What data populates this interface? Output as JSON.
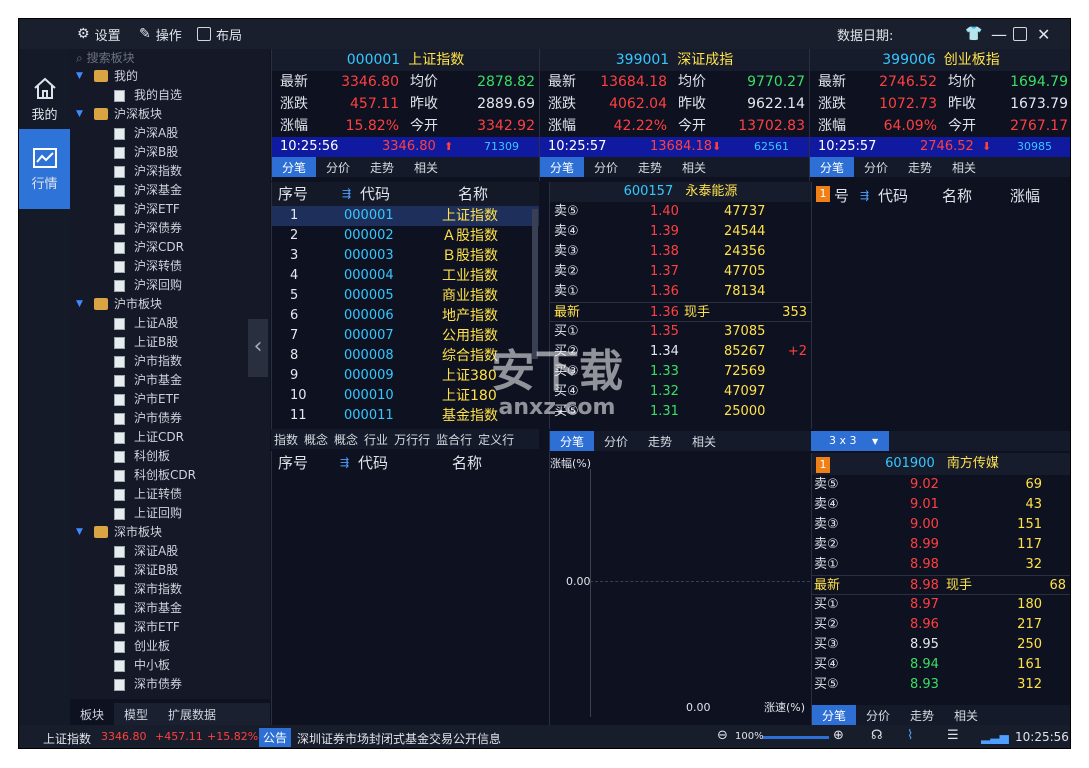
{
  "titlebar": {
    "settings": "设置",
    "operate": "操作",
    "layout": "布局",
    "date_label": "数据日期:"
  },
  "rail": {
    "mine": "我的",
    "market": "行情"
  },
  "tree": {
    "search_placeholder": "搜索板块",
    "groups": [
      {
        "label": "我的",
        "items": [
          "我的自选"
        ]
      },
      {
        "label": "沪深板块",
        "items": [
          "沪深A股",
          "沪深B股",
          "沪深指数",
          "沪深基金",
          "沪深ETF",
          "沪深债券",
          "沪深CDR",
          "沪深转债",
          "沪深回购"
        ]
      },
      {
        "label": "沪市板块",
        "items": [
          "上证A股",
          "上证B股",
          "沪市指数",
          "沪市基金",
          "沪市ETF",
          "沪市债券",
          "上证CDR",
          "科创板",
          "科创板CDR",
          "上证转债",
          "上证回购"
        ]
      },
      {
        "label": "深市板块",
        "items": [
          "深证A股",
          "深证B股",
          "深市指数",
          "深市基金",
          "深市ETF",
          "创业板",
          "中小板",
          "深市债券"
        ]
      }
    ],
    "tabs": [
      "板块",
      "模型",
      "扩展数据"
    ]
  },
  "labels": {
    "latest": "最新",
    "avg": "均价",
    "change": "涨跌",
    "prev_close": "昨收",
    "pct": "涨幅",
    "open": "今开",
    "spot": "现手"
  },
  "subtabs": [
    "分笔",
    "分价",
    "走势",
    "相关"
  ],
  "index_panels": [
    {
      "code": "000001",
      "name": "上证指数",
      "latest": "3346.80",
      "avg": "2878.82",
      "change": "457.11",
      "prev_close": "2889.69",
      "pct": "15.82%",
      "open": "3342.92",
      "time": "10:25:56",
      "tick_price": "3346.80",
      "tick_dir": "⬆",
      "tick_vol": "71309"
    },
    {
      "code": "399001",
      "name": "深证成指",
      "latest": "13684.18",
      "avg": "9770.27",
      "change": "4062.04",
      "prev_close": "9622.14",
      "pct": "42.22%",
      "open": "13702.83",
      "time": "10:25:57",
      "tick_price": "13684.18",
      "tick_dir": "⬇",
      "tick_vol": "62561"
    },
    {
      "code": "399006",
      "name": "创业板指",
      "latest": "2746.52",
      "avg": "1694.79",
      "change": "1072.73",
      "prev_close": "1673.79",
      "pct": "64.09%",
      "open": "2767.17",
      "time": "10:25:57",
      "tick_price": "2746.52",
      "tick_dir": "⬇",
      "tick_vol": "30985"
    }
  ],
  "list1": {
    "headers": [
      "序号",
      "代码",
      "名称"
    ],
    "rows": [
      {
        "n": "1",
        "code": "000001",
        "name": "上证指数"
      },
      {
        "n": "2",
        "code": "000002",
        "name": "Ａ股指数"
      },
      {
        "n": "3",
        "code": "000003",
        "name": "Ｂ股指数"
      },
      {
        "n": "4",
        "code": "000004",
        "name": "工业指数"
      },
      {
        "n": "5",
        "code": "000005",
        "name": "商业指数"
      },
      {
        "n": "6",
        "code": "000006",
        "name": "地产指数"
      },
      {
        "n": "7",
        "code": "000007",
        "name": "公用指数"
      },
      {
        "n": "8",
        "code": "000008",
        "name": "综合指数"
      },
      {
        "n": "9",
        "code": "000009",
        "name": "上证380"
      },
      {
        "n": "10",
        "code": "000010",
        "name": "上证180"
      },
      {
        "n": "11",
        "code": "000011",
        "name": "基金指数"
      }
    ]
  },
  "list_tabs": [
    "指数",
    "概念",
    "概念",
    "行业",
    "万行行",
    "监合行",
    "定义行"
  ],
  "list2": {
    "headers": [
      "序号",
      "代码",
      "名称"
    ]
  },
  "list3": {
    "headers": [
      "号",
      "代码",
      "名称",
      "涨幅"
    ],
    "badge": "1"
  },
  "orderbook1": {
    "code": "600157",
    "name": "永泰能源",
    "asks": [
      {
        "l": "卖⑤",
        "p": "1.40",
        "v": "47737"
      },
      {
        "l": "卖④",
        "p": "1.39",
        "v": "24544"
      },
      {
        "l": "卖③",
        "p": "1.38",
        "v": "24356"
      },
      {
        "l": "卖②",
        "p": "1.37",
        "v": "47705"
      },
      {
        "l": "卖①",
        "p": "1.36",
        "v": "78134"
      }
    ],
    "last": {
      "l": "最新",
      "p": "1.36",
      "v": "353"
    },
    "bids": [
      {
        "l": "买①",
        "p": "1.35",
        "v": "37085",
        "d": ""
      },
      {
        "l": "买②",
        "p": "1.34",
        "v": "85267",
        "d": "+2"
      },
      {
        "l": "买③",
        "p": "1.33",
        "v": "72569",
        "d": ""
      },
      {
        "l": "买④",
        "p": "1.32",
        "v": "47097",
        "d": ""
      },
      {
        "l": "买⑤",
        "p": "1.31",
        "v": "25000",
        "d": ""
      }
    ]
  },
  "chart": {
    "ylabel": "涨幅(%)",
    "y0": "0.00",
    "x0": "0.00",
    "xlabel": "涨速(%)"
  },
  "grid_selector": "3 x 3",
  "orderbook2": {
    "badge": "1",
    "code": "601900",
    "name": "南方传媒",
    "asks": [
      {
        "l": "卖⑤",
        "p": "9.02",
        "v": "69"
      },
      {
        "l": "卖④",
        "p": "9.01",
        "v": "43"
      },
      {
        "l": "卖③",
        "p": "9.00",
        "v": "151"
      },
      {
        "l": "卖②",
        "p": "8.99",
        "v": "117"
      },
      {
        "l": "卖①",
        "p": "8.98",
        "v": "32"
      }
    ],
    "last": {
      "l": "最新",
      "p": "8.98",
      "v": "68"
    },
    "bids": [
      {
        "l": "买①",
        "p": "8.97",
        "v": "180"
      },
      {
        "l": "买②",
        "p": "8.96",
        "v": "217"
      },
      {
        "l": "买③",
        "p": "8.95",
        "v": "250"
      },
      {
        "l": "买④",
        "p": "8.94",
        "v": "161"
      },
      {
        "l": "买⑤",
        "p": "8.93",
        "v": "312"
      }
    ]
  },
  "status": {
    "index_name": "上证指数",
    "value": "3346.80",
    "change": "+457.11",
    "pct": "+15.82%",
    "notice_label": "公告",
    "notice": "深圳证券市场封闭式基金交易公开信息",
    "zoom": "100%",
    "time": "10:25:56"
  },
  "watermark": {
    "big": "安下载",
    "small": "anxz.com"
  }
}
